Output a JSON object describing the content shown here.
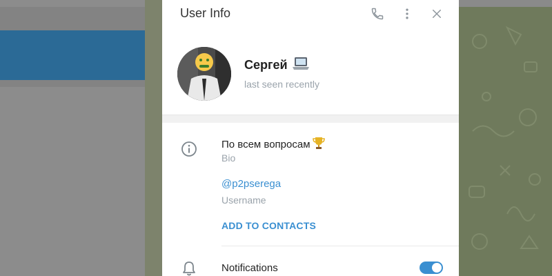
{
  "header": {
    "title": "User Info"
  },
  "icons": {
    "call": "phone-icon",
    "more": "more-vertical-icon",
    "close": "close-icon",
    "info": "info-icon",
    "bell": "bell-icon",
    "laptop": "laptop-emoji-icon",
    "trophy": "trophy-emoji-icon"
  },
  "profile": {
    "name": "Сергей",
    "status": "last seen recently"
  },
  "info": {
    "bio": "По всем вопросам",
    "bio_label": "Bio",
    "username": "@p2pserega",
    "username_label": "Username",
    "add_contacts": "ADD TO CONTACTS"
  },
  "notifications": {
    "label": "Notifications",
    "enabled": true
  },
  "colors": {
    "accent": "#3a8fd1",
    "muted_text": "#9aa3ab",
    "overlay_sidebar_selected": "#2b6a96"
  }
}
